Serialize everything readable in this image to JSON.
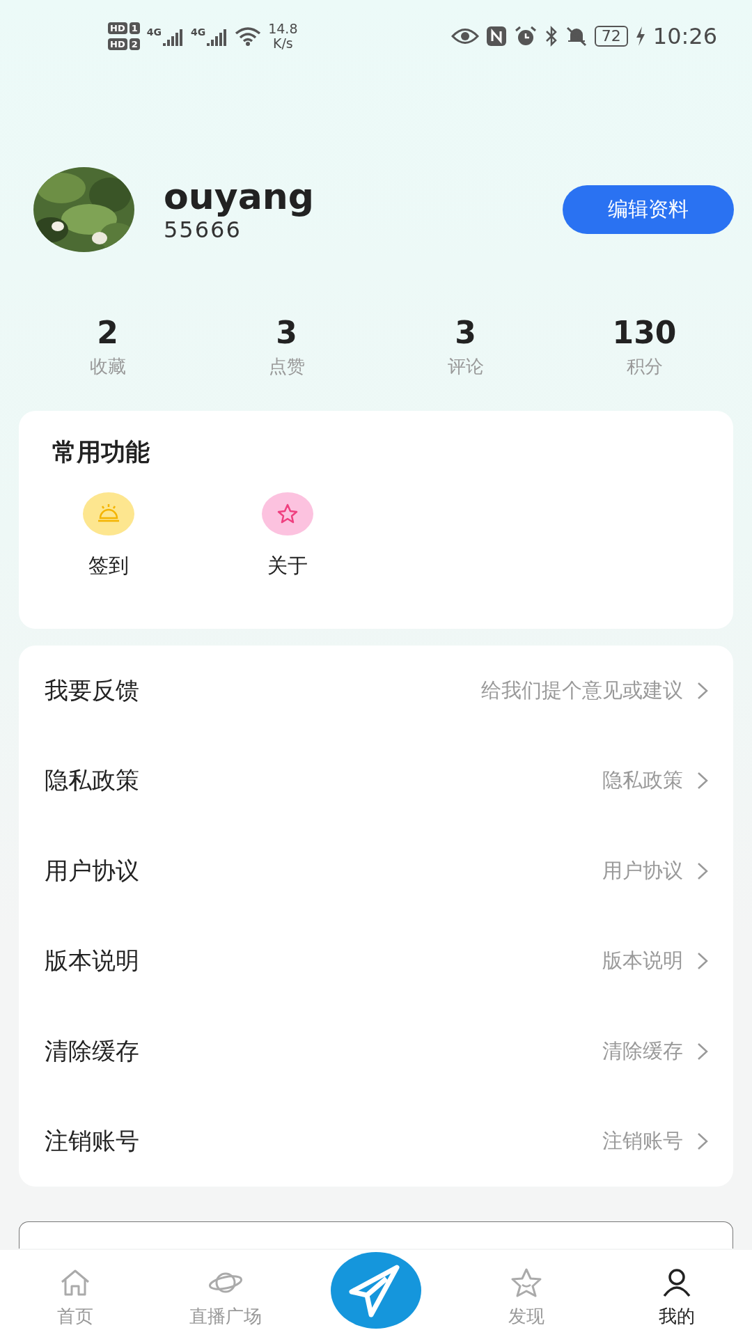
{
  "status_bar": {
    "sims": [
      {
        "hd": "HD",
        "slot": "1"
      },
      {
        "hd": "HD",
        "slot": "2"
      }
    ],
    "networks": [
      "4G",
      "4G"
    ],
    "speed": "14.8",
    "speed_unit": "K/s",
    "battery": "72",
    "time": "10:26"
  },
  "profile": {
    "name": "ouyang",
    "id": "55666",
    "edit_button": "编辑资料"
  },
  "stats": [
    {
      "value": "2",
      "label": "收藏"
    },
    {
      "value": "3",
      "label": "点赞"
    },
    {
      "value": "3",
      "label": "评论"
    },
    {
      "value": "130",
      "label": "积分"
    }
  ],
  "functions": {
    "title": "常用功能",
    "items": [
      {
        "kind": "checkin",
        "label": "签到",
        "color": "#fde68f"
      },
      {
        "kind": "about",
        "label": "关于",
        "color": "#fcc2df"
      }
    ]
  },
  "menu": [
    {
      "label": "我要反馈",
      "hint": "给我们提个意见或建议"
    },
    {
      "label": "隐私政策",
      "hint": "隐私政策"
    },
    {
      "label": "用户协议",
      "hint": "用户协议"
    },
    {
      "label": "版本说明",
      "hint": "版本说明"
    },
    {
      "label": "清除缓存",
      "hint": "清除缓存"
    },
    {
      "label": "注销账号",
      "hint": "注销账号"
    }
  ],
  "logout_button": {
    "kind": "outlined"
  },
  "tab_bar": [
    {
      "kind": "home",
      "label": "首页",
      "selected": false
    },
    {
      "kind": "planet",
      "label": "直播广场",
      "selected": false
    },
    {
      "kind": "send",
      "selected": false
    },
    {
      "kind": "star",
      "label": "发现",
      "selected": false
    },
    {
      "kind": "user",
      "label": "我的",
      "selected": true
    }
  ]
}
